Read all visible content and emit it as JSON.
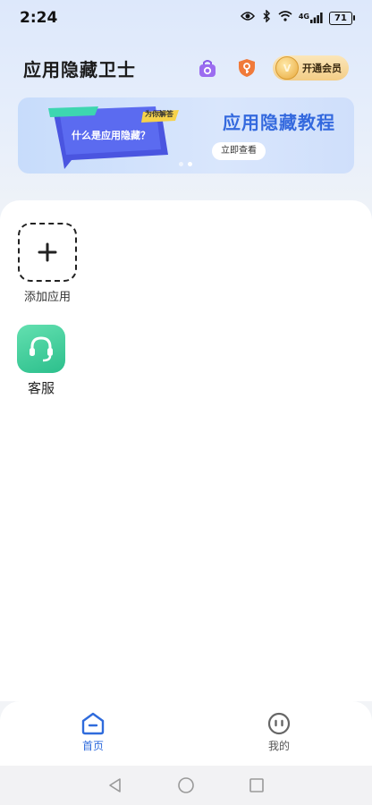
{
  "status_bar": {
    "time": "2:24",
    "battery": "71",
    "network": "4G"
  },
  "header": {
    "title": "应用隐藏卫士",
    "icons": [
      "lock-bag-icon",
      "shield-key-icon"
    ],
    "vip_label": "开通会员"
  },
  "banner": {
    "art_tag": "为你解答",
    "art_text": "什么是应用隐藏？",
    "title": "应用隐藏教程",
    "button_label": "立即查看",
    "active_slide": 2,
    "slide_count": 2
  },
  "apps": [
    {
      "label": "添加应用",
      "icon": "plus-icon"
    }
  ],
  "service": {
    "label": "客服",
    "icon": "headset-icon"
  },
  "bottom_nav": [
    {
      "label": "首页",
      "icon": "home-icon",
      "active": true
    },
    {
      "label": "我的",
      "icon": "profile-face-icon",
      "active": false
    }
  ],
  "colors": {
    "accent": "#2f6bdc",
    "banner_title": "#3469de",
    "service_green": "#2cbf8c",
    "vip_gold": "#f3cd86"
  }
}
